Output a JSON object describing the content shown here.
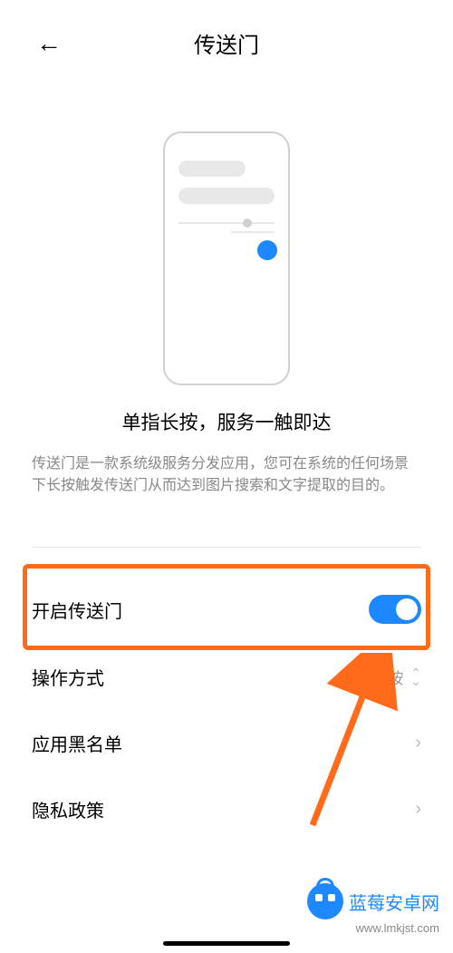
{
  "header": {
    "title": "传送门"
  },
  "hero": {
    "subtitle": "单指长按，服务一触即达",
    "description": "传送门是一款系统级服务分发应用，您可在系统的任何场景下长按触发传送门从而达到图片搜索和文字提取的目的。"
  },
  "settings": {
    "enable": {
      "label": "开启传送门",
      "state": "on"
    },
    "operation": {
      "label": "操作方式",
      "value": "单指长按"
    },
    "blacklist": {
      "label": "应用黑名单"
    },
    "privacy": {
      "label": "隐私政策"
    }
  },
  "watermark": {
    "name": "蓝莓安卓网",
    "url": "www.lmkjst.com"
  }
}
